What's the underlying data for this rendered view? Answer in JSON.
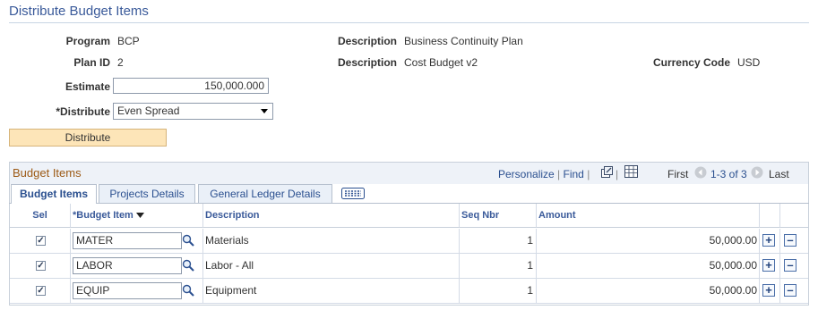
{
  "page": {
    "title": "Distribute Budget Items"
  },
  "header": {
    "program_label": "Program",
    "program_value": "BCP",
    "desc1_label": "Description",
    "desc1_value": "Business Continuity Plan",
    "planid_label": "Plan ID",
    "planid_value": "2",
    "desc2_label": "Description",
    "desc2_value": "Cost Budget v2",
    "currency_label": "Currency Code",
    "currency_value": "USD",
    "estimate_label": "Estimate",
    "estimate_value": "150,000.000",
    "distribute_label": "*Distribute",
    "distribute_value": "Even Spread",
    "distribute_button": "Distribute"
  },
  "grid": {
    "title": "Budget Items",
    "personalize": "Personalize",
    "find": "Find",
    "first": "First",
    "range": "1-3 of 3",
    "last": "Last",
    "tabs": [
      "Budget Items",
      "Projects Details",
      "General Ledger Details"
    ],
    "columns": {
      "sel": "Sel",
      "budget_item": "*Budget Item",
      "description": "Description",
      "seq": "Seq Nbr",
      "amount": "Amount"
    },
    "rows": [
      {
        "selected": true,
        "item": "MATER",
        "description": "Materials",
        "seq": "1",
        "amount": "50,000.00"
      },
      {
        "selected": true,
        "item": "LABOR",
        "description": "Labor - All",
        "seq": "1",
        "amount": "50,000.00"
      },
      {
        "selected": true,
        "item": "EQUIP",
        "description": "Equipment",
        "seq": "1",
        "amount": "50,000.00"
      }
    ]
  },
  "icons": {
    "lookup": "magnifier-icon",
    "add": "plus-icon",
    "remove": "minus-icon",
    "zoom": "new-window-icon",
    "download": "spreadsheet-icon",
    "prev": "prev-arrow-icon",
    "next": "next-arrow-icon",
    "show_all": "show-all-columns-icon"
  },
  "colors": {
    "title": "#3a5a9a",
    "grid_title": "#9c5a16",
    "button": "#fde5b8",
    "link": "#2a4f8f"
  }
}
